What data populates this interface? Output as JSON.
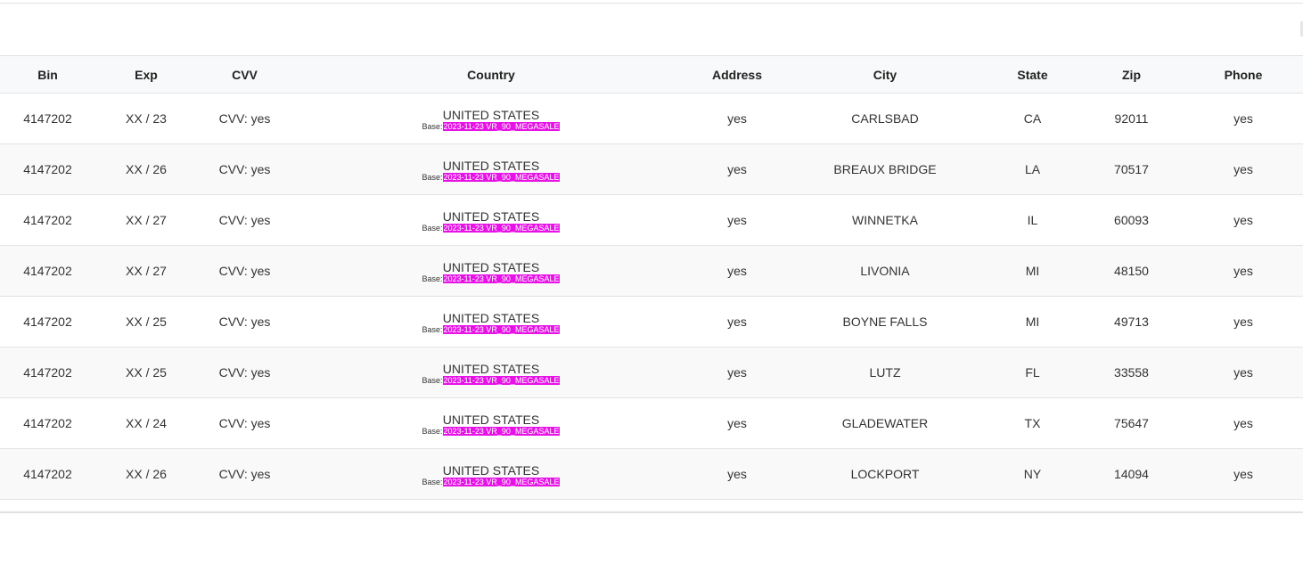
{
  "table": {
    "headers": {
      "bin": "Bin",
      "exp": "Exp",
      "cvv": "CVV",
      "country": "Country",
      "address": "Address",
      "city": "City",
      "state": "State",
      "zip": "Zip",
      "phone": "Phone"
    },
    "base_prefix": "Base:",
    "rows": [
      {
        "bin": "4147202",
        "exp": "XX / 23",
        "cvv": "CVV: yes",
        "country": "UNITED STATES",
        "base": "2023-11-23 VR_90_MEGASALE",
        "address": "yes",
        "city": "CARLSBAD",
        "state": "CA",
        "zip": "92011",
        "phone": "yes"
      },
      {
        "bin": "4147202",
        "exp": "XX / 26",
        "cvv": "CVV: yes",
        "country": "UNITED STATES",
        "base": "2023-11-23 VR_90_MEGASALE",
        "address": "yes",
        "city": "BREAUX BRIDGE",
        "state": "LA",
        "zip": "70517",
        "phone": "yes"
      },
      {
        "bin": "4147202",
        "exp": "XX / 27",
        "cvv": "CVV: yes",
        "country": "UNITED STATES",
        "base": "2023-11-23 VR_90_MEGASALE",
        "address": "yes",
        "city": "WINNETKA",
        "state": "IL",
        "zip": "60093",
        "phone": "yes"
      },
      {
        "bin": "4147202",
        "exp": "XX / 27",
        "cvv": "CVV: yes",
        "country": "UNITED STATES",
        "base": "2023-11-23 VR_90_MEGASALE",
        "address": "yes",
        "city": "LIVONIA",
        "state": "MI",
        "zip": "48150",
        "phone": "yes"
      },
      {
        "bin": "4147202",
        "exp": "XX / 25",
        "cvv": "CVV: yes",
        "country": "UNITED STATES",
        "base": "2023-11-23 VR_90_MEGASALE",
        "address": "yes",
        "city": "BOYNE FALLS",
        "state": "MI",
        "zip": "49713",
        "phone": "yes"
      },
      {
        "bin": "4147202",
        "exp": "XX / 25",
        "cvv": "CVV: yes",
        "country": "UNITED STATES",
        "base": "2023-11-23 VR_90_MEGASALE",
        "address": "yes",
        "city": "LUTZ",
        "state": "FL",
        "zip": "33558",
        "phone": "yes"
      },
      {
        "bin": "4147202",
        "exp": "XX / 24",
        "cvv": "CVV: yes",
        "country": "UNITED STATES",
        "base": "2023-11-23 VR_90_MEGASALE",
        "address": "yes",
        "city": "GLADEWATER",
        "state": "TX",
        "zip": "75647",
        "phone": "yes"
      },
      {
        "bin": "4147202",
        "exp": "XX / 26",
        "cvv": "CVV: yes",
        "country": "UNITED STATES",
        "base": "2023-11-23 VR_90_MEGASALE",
        "address": "yes",
        "city": "LOCKPORT",
        "state": "NY",
        "zip": "14094",
        "phone": "yes"
      }
    ]
  },
  "colors": {
    "header_bg": "#f8f9fa",
    "stripe_bg": "#f9f9f9",
    "base_tag_bg": "#e612e6",
    "base_tag_text": "#ffffff"
  }
}
